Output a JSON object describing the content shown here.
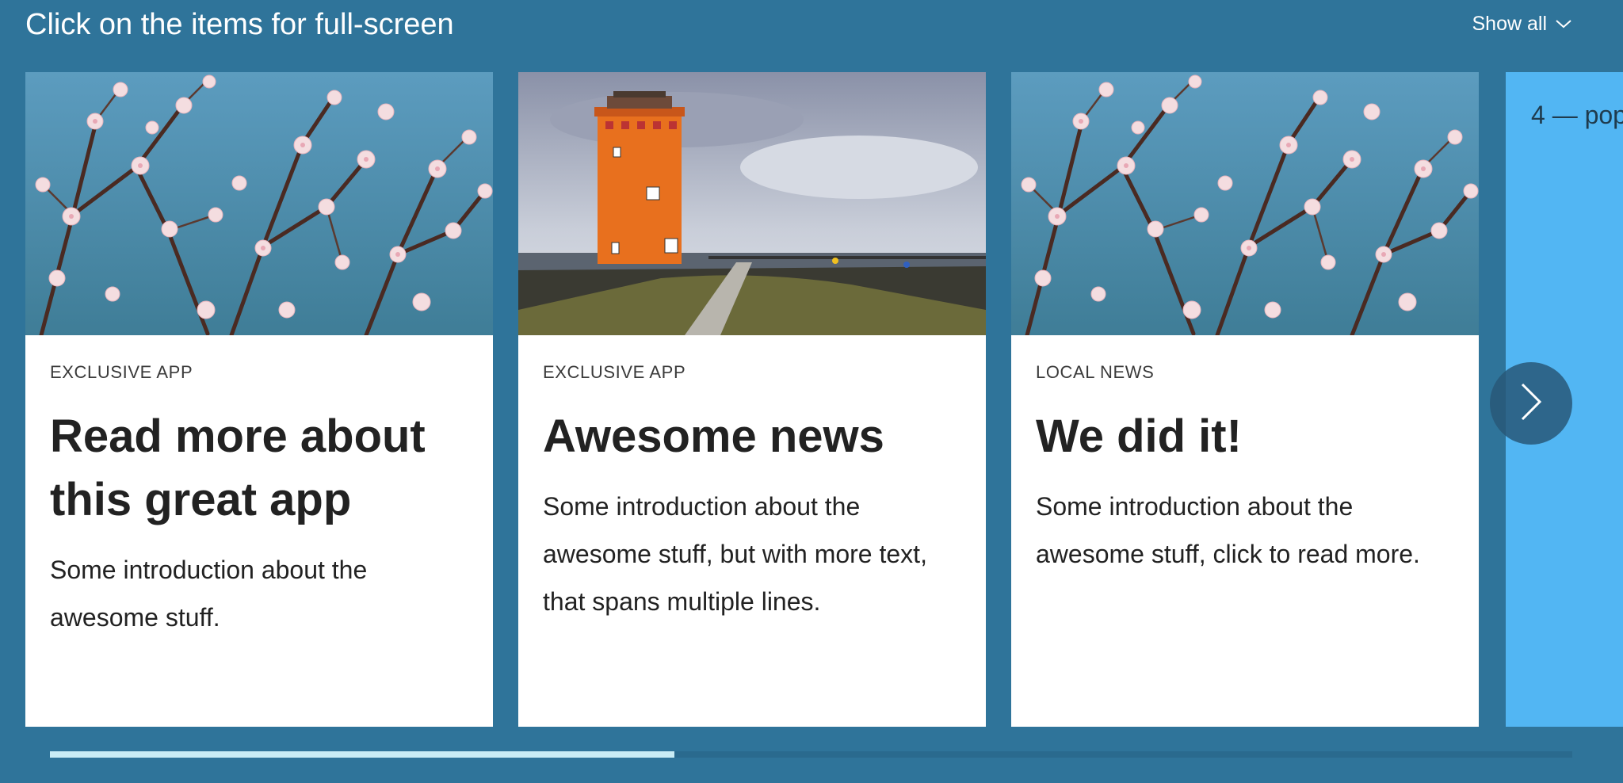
{
  "header": {
    "title": "Click on the items for full-screen",
    "show_all_label": "Show all"
  },
  "cards": [
    {
      "category": "EXCLUSIVE APP",
      "title": "Read more about this great app",
      "intro": "Some introduction about the awesome stuff.",
      "image": "cherry-blossom-branches"
    },
    {
      "category": "EXCLUSIVE APP",
      "title": "Awesome news",
      "intro": "Some introduction about the awesome stuff, but with more text, that spans multiple lines.",
      "image": "orange-lighthouse-coast"
    },
    {
      "category": "LOCAL NEWS",
      "title": "We did it!",
      "intro": "Some introduction about the awesome stuff, click to read more.",
      "image": "cherry-blossom-branches"
    },
    {
      "label": "4 — pop"
    }
  ],
  "navigation": {
    "next_icon": "chevron-right-icon",
    "show_all_icon": "chevron-down-icon"
  },
  "progress": {
    "value": 0.41
  },
  "colors": {
    "background": "#2f749a",
    "card_background": "#ffffff",
    "partial_card": "#52b6f3",
    "progress_fill": "#c9ecf5",
    "progress_track": "#2a6a8e",
    "next_button": "#285878"
  }
}
